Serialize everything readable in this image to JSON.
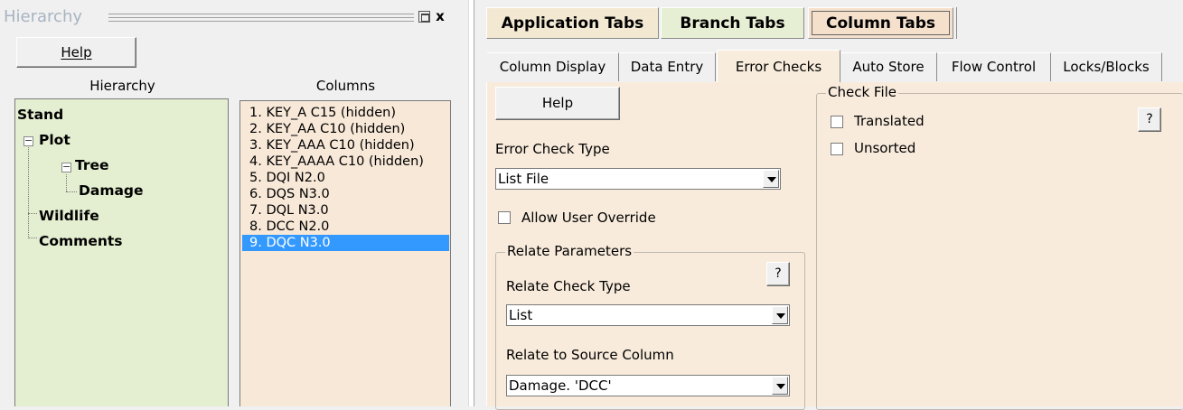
{
  "hierarchy_panel": {
    "title": "Hierarchy",
    "help_button": "Help",
    "hierarchy_label": "Hierarchy",
    "columns_label": "Columns",
    "tree": {
      "stand": "Stand",
      "plot": "Plot",
      "tree": "Tree",
      "damage": "Damage",
      "wildlife": "Wildlife",
      "comments": "Comments"
    },
    "columns": [
      "1. KEY_A C15 (hidden)",
      "2. KEY_AA C10 (hidden)",
      "3. KEY_AAA C10 (hidden)",
      "4. KEY_AAAA C10 (hidden)",
      "5. DQI N2.0",
      "6. DQS N3.0",
      "7. DQL N3.0",
      "8. DCC N2.0",
      "9. DQC N3.0"
    ],
    "selected_column_index": 8,
    "close_glyph": "x"
  },
  "top_tabs": [
    "Application Tabs",
    "Branch Tabs",
    "Column Tabs"
  ],
  "active_top_tab": "Column Tabs",
  "sub_tabs": [
    "Column Display",
    "Data Entry",
    "Error Checks",
    "Auto Store",
    "Flow Control",
    "Locks/Blocks"
  ],
  "active_sub_tab": "Error Checks",
  "error_checks": {
    "help_button": "Help",
    "error_check_type_label": "Error Check Type",
    "error_check_type_value": "List File",
    "allow_user_override_label": "Allow User Override",
    "allow_user_override_checked": false,
    "relate_parameters": {
      "title": "Relate Parameters",
      "help_button": "?",
      "relate_check_type_label": "Relate Check Type",
      "relate_check_type_value": "List",
      "relate_to_source_label": "Relate to Source Column",
      "relate_to_source_value": "Damage. 'DCC'"
    },
    "check_file": {
      "title": "Check File",
      "help_button": "?",
      "translated_label": "Translated",
      "translated_checked": false,
      "unsorted_label": "Unsorted",
      "unsorted_checked": false
    }
  },
  "colors": {
    "tree_background": "#e4eed0",
    "columns_background": "#f8e8d8",
    "selection": "#3399ff",
    "content_background": "#f8ebdb",
    "title_text": "#a8b4c2"
  }
}
